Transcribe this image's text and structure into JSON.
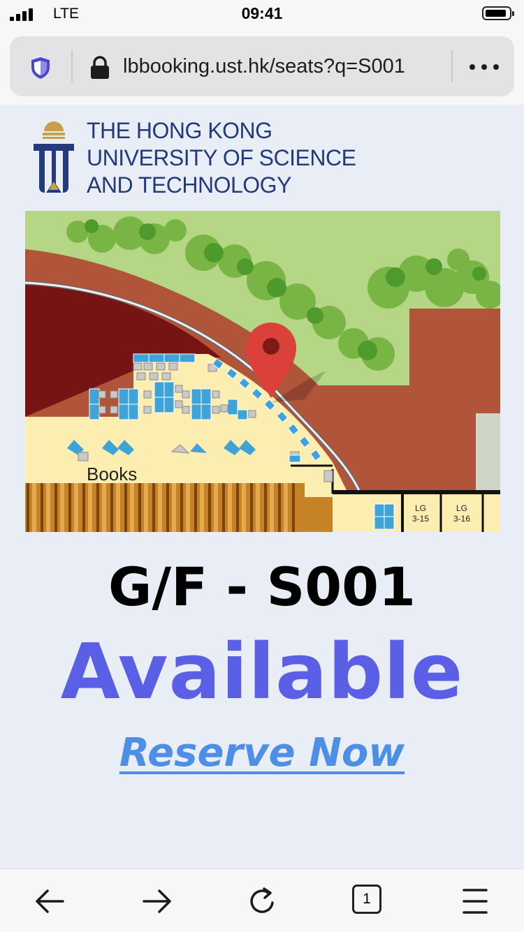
{
  "status_bar": {
    "carrier": "LTE",
    "time": "09:41"
  },
  "browser": {
    "url": "lbbooking.ust.hk/seats?q=S001",
    "tab_count": "1"
  },
  "logo": {
    "lines": [
      "THE HONG KONG",
      "UNIVERSITY OF SCIENCE",
      "AND TECHNOLOGY"
    ]
  },
  "map": {
    "books_label": "Books",
    "rooms": [
      {
        "line1": "LG",
        "line2": "3-15"
      },
      {
        "line1": "LG",
        "line2": "3-16"
      }
    ]
  },
  "seat": {
    "title": "G/F - S001",
    "status": "Available",
    "status_color": "#5b5fe6",
    "action": "Reserve Now",
    "action_color": "#4d8fe6"
  },
  "colors": {
    "brand_navy": "#233b7a",
    "pin_red": "#d9413a"
  }
}
